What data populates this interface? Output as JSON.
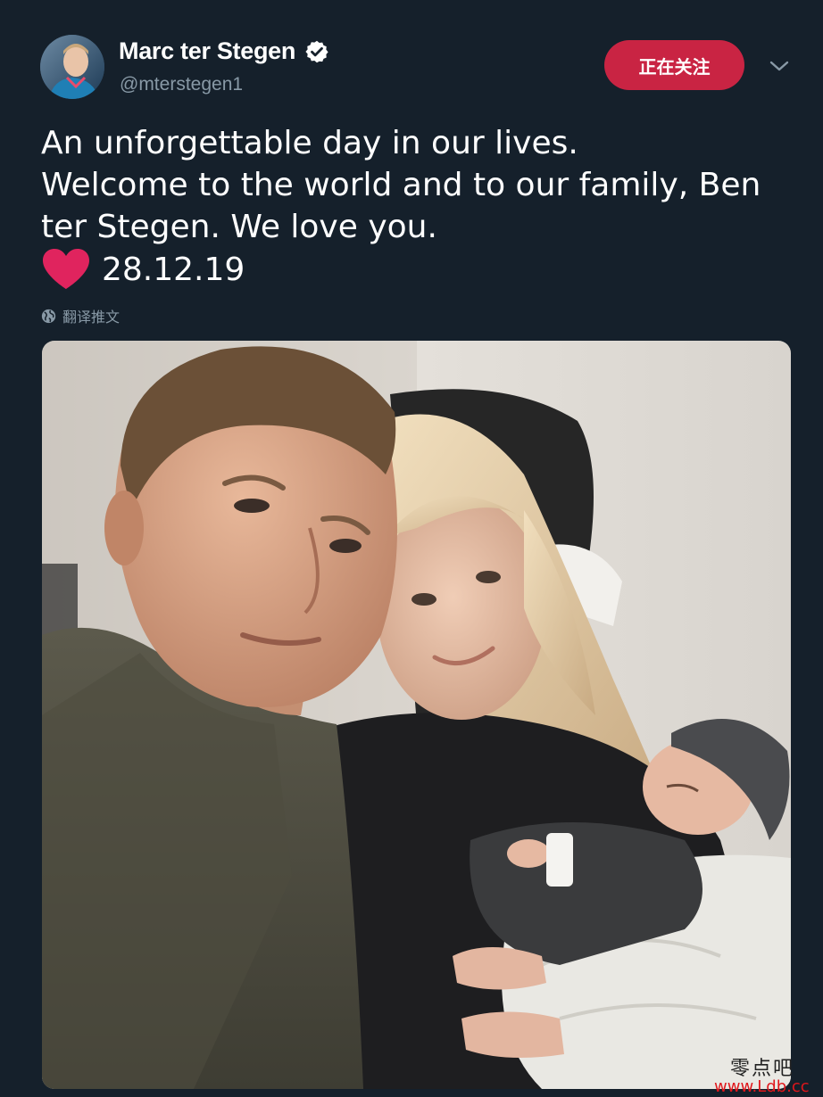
{
  "tweet": {
    "author": {
      "display_name": "Marc ter Stegen",
      "handle": "@mterstegen1",
      "verified": true,
      "avatar_icon": "player-avatar"
    },
    "follow_button_label": "正在关注",
    "menu_icon": "chevron-down-icon",
    "text_lines": [
      "An unforgettable day in our lives.",
      "Welcome to the world and to our family, Ben",
      "ter Stegen. We love you."
    ],
    "emoji": "heart-icon",
    "date_text": "28.12.19",
    "translate_label": "翻译推文",
    "translate_icon": "globe-icon",
    "media": {
      "type": "photo",
      "alt": "family-selfie-photo"
    }
  },
  "watermark": {
    "top": "零点吧",
    "bottom": "www.Ldb.cc"
  },
  "colors": {
    "background": "#15202b",
    "follow_button": "#c92443",
    "secondary_text": "#8899a6",
    "heart": "#e0245e"
  }
}
